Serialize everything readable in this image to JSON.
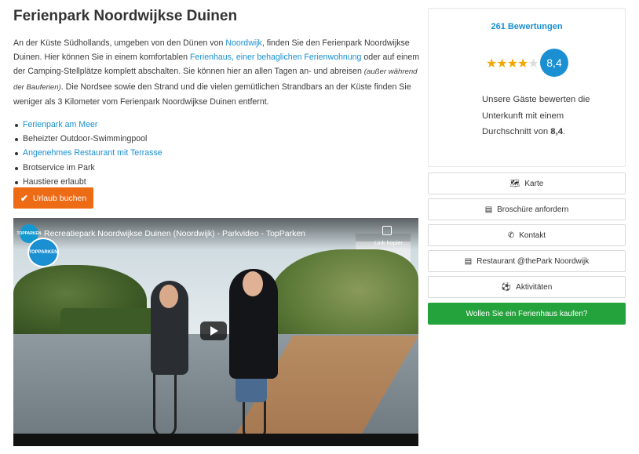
{
  "page": {
    "title": "Ferienpark Noordwijkse Duinen",
    "intro": {
      "p1": "An der Küste Südhollands, umgeben von den Dünen von ",
      "link1": "Noordwijk",
      "p2": ", finden Sie den Ferienpark Noordwijkse Duinen. Hier können Sie in einem komfortablen ",
      "link2": "Ferienhaus, einer behaglichen Ferienwohnung",
      "p3": " oder auf einem der Camping-Stellplätze komplett abschalten. Sie können hier an allen Tagen an- und abreisen ",
      "italic": "(außer während der Bauferien)",
      "p4": ". Die Nordsee sowie den Strand und die vielen gemütlichen Strandbars an der Küste finden Sie weniger als 3 Kilometer vom Ferienpark Noordwijkse Duinen entfernt."
    },
    "features": [
      {
        "label": "Ferienpark am Meer",
        "is_link": true
      },
      {
        "label": "Beheizter Outdoor-Swimmingpool",
        "is_link": false
      },
      {
        "label": "Angenehmes Restaurant mit Terrasse",
        "is_link": true
      },
      {
        "label": "Brotservice im Park",
        "is_link": false
      },
      {
        "label": "Haustiere erlaubt",
        "is_link": false
      }
    ],
    "book_button": "Urlaub buchen"
  },
  "video": {
    "title": "Recreatiepark Noordwijkse Duinen (Noordwijk) - Parkvideo - TopParken",
    "copy_label": "Link kopier...",
    "channel_logo_text": "TOPPARKEN",
    "watermark_text": "TOPPARKEN"
  },
  "sidebar": {
    "reviews_link": "261 Bewertungen",
    "stars_rating": 4,
    "stars_max": 5,
    "score": "8,4",
    "summary_text": "Unsere Gäste bewerten die Unterkunft mit einem Durchschnitt von ",
    "summary_score": "8,4",
    "summary_end": ".",
    "buttons": [
      {
        "label": "Karte",
        "icon": "map-icon"
      },
      {
        "label": "Broschüre anfordern",
        "icon": "brochure-icon"
      },
      {
        "label": "Kontakt",
        "icon": "phone-icon"
      },
      {
        "label": "Restaurant @thePark Noordwijk",
        "icon": "restaurant-icon"
      },
      {
        "label": "Aktivitäten",
        "icon": "football-icon"
      }
    ],
    "buy_button": "Wollen Sie ein Ferienhaus kaufen?"
  },
  "colors": {
    "link": "#1a8fd1",
    "orange": "#ee6b16",
    "green": "#24a33c",
    "star": "#f0a800"
  }
}
